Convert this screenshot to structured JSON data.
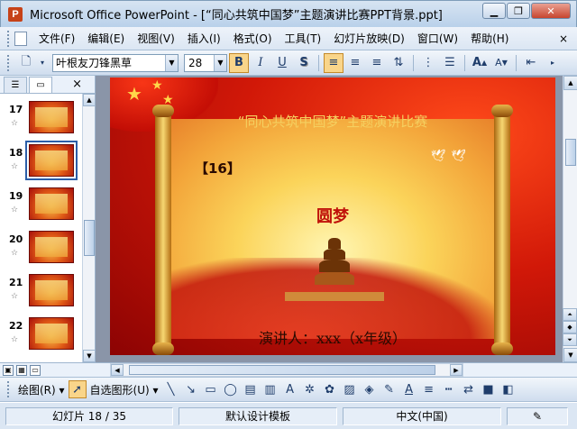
{
  "window": {
    "title": "Microsoft Office PowerPoint - [“同心共筑中国梦”主题演讲比赛PPT背景.ppt]",
    "app_icon": "powerpoint-icon"
  },
  "menu": {
    "items": [
      "文件(F)",
      "编辑(E)",
      "视图(V)",
      "插入(I)",
      "格式(O)",
      "工具(T)",
      "幻灯片放映(D)",
      "窗口(W)",
      "帮助(H)"
    ],
    "close_mark": "×"
  },
  "toolbar": {
    "font": "叶根友刀锋黑草",
    "size": "28",
    "bold": "B",
    "italic": "I",
    "underline": "U",
    "shadow": "S",
    "grow_font": "A",
    "shrink_font": "A"
  },
  "slides_panel": {
    "thumbnails": [
      {
        "num": "17"
      },
      {
        "num": "18"
      },
      {
        "num": "19"
      },
      {
        "num": "20"
      },
      {
        "num": "21"
      },
      {
        "num": "22"
      }
    ],
    "selected": "18",
    "close": "×"
  },
  "slide": {
    "title": "“同心共筑中国梦”主题演讲比赛",
    "number": "【16】",
    "subtitle": "圆梦",
    "speaker": "演讲人：xxx（x年级）"
  },
  "drawing": {
    "draw_label": "绘图(R)",
    "autoshapes_label": "自选图形(U)"
  },
  "status": {
    "slide_pos": "幻灯片 18 / 35",
    "template": "默认设计模板",
    "language": "中文(中国)"
  },
  "colors": {
    "accent": "#2b5ea8",
    "slide_title": "#f5d060",
    "slide_subtitle": "#c0120a"
  }
}
